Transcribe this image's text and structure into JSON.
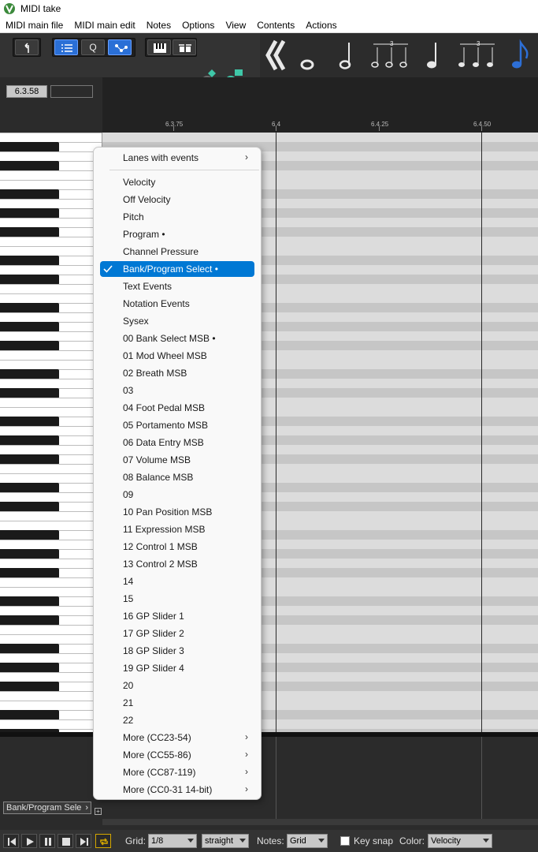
{
  "window": {
    "title": "MIDI take"
  },
  "menubar": [
    "MIDI main file",
    "MIDI main edit",
    "Notes",
    "Options",
    "View",
    "Contents",
    "Actions"
  ],
  "toolbar": {
    "quantize_label": "Q"
  },
  "position": {
    "value": "6.3.58"
  },
  "ruler": {
    "ticks": [
      "6.3.75",
      "6.4",
      "6.4.25",
      "6.4.50"
    ]
  },
  "context_menu": {
    "lanes_with_events": "Lanes with events",
    "items": [
      "Velocity",
      "Off Velocity",
      "Pitch",
      "Program •",
      "Channel Pressure",
      "Bank/Program Select •",
      "Text Events",
      "Notation Events",
      "Sysex",
      "00 Bank Select MSB •",
      "01 Mod Wheel MSB",
      "02 Breath MSB",
      "03",
      "04 Foot Pedal MSB",
      "05 Portamento MSB",
      "06 Data Entry MSB",
      "07 Volume MSB",
      "08 Balance MSB",
      "09",
      "10 Pan Position MSB",
      "11 Expression MSB",
      "12 Control 1 MSB",
      "13 Control 2 MSB",
      "14",
      "15",
      "16 GP Slider 1",
      "17 GP Slider 2",
      "18 GP Slider 3",
      "19 GP Slider 4",
      "20",
      "21",
      "22"
    ],
    "selected_item": "Bank/Program Select •",
    "more": [
      "More (CC23-54)",
      "More (CC55-86)",
      "More (CC87-119)",
      "More (CC0-31 14-bit)"
    ]
  },
  "cc_lane": {
    "selected": "Bank/Program Sele",
    "add_symbol": "+"
  },
  "statusbar": {
    "grid_label": "Grid:",
    "grid_value": "1/8",
    "grid_type": "straight",
    "notes_label": "Notes:",
    "notes_value": "Grid",
    "key_snap_label": "Key snap",
    "key_snap_checked": false,
    "color_label": "Color:",
    "color_value": "Velocity"
  },
  "colors": {
    "accent": "#0078d4",
    "toolbar_active": "#2a6fd6",
    "row_light": "#dcdcdc",
    "row_dark": "#c6c6c6",
    "loop_highlight": "#d4a700",
    "note_highlight": "#2d6fd6"
  }
}
